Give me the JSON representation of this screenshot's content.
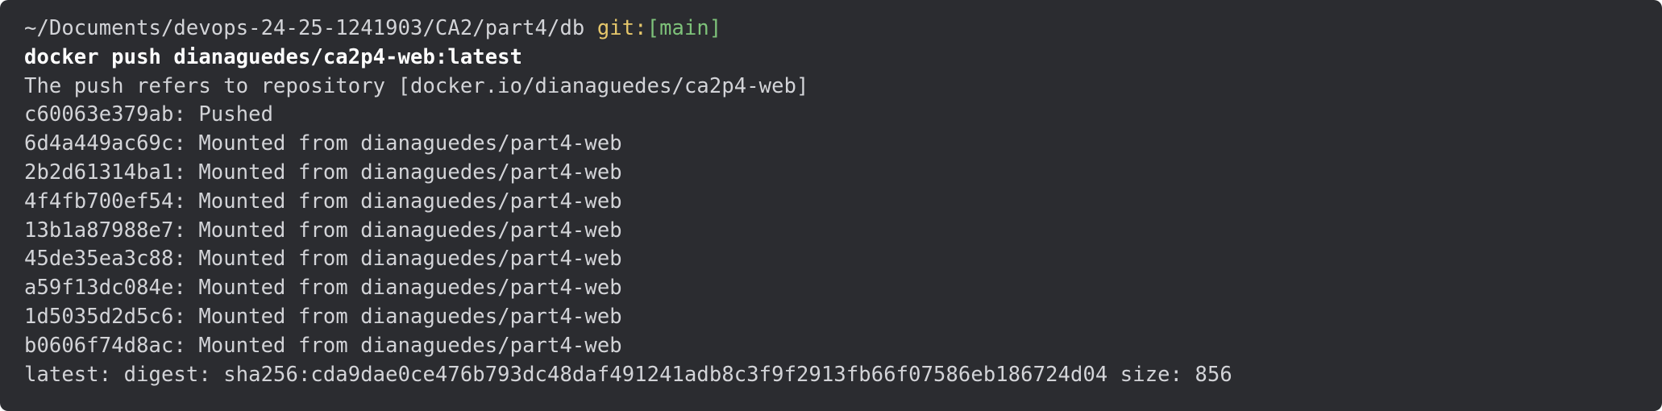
{
  "prompt": {
    "path": "~/Documents/devops-24-25-1241903/CA2/part4/db",
    "git_label": "git:",
    "branch_open": "[",
    "branch": "main",
    "branch_close": "]"
  },
  "command": "docker push dianaguedes/ca2p4-web:latest",
  "output": {
    "repo_line": "The push refers to repository [docker.io/dianaguedes/ca2p4-web]",
    "layers": [
      {
        "id": "c60063e379ab",
        "status": "Pushed"
      },
      {
        "id": "6d4a449ac69c",
        "status": "Mounted from dianaguedes/part4-web"
      },
      {
        "id": "2b2d61314ba1",
        "status": "Mounted from dianaguedes/part4-web"
      },
      {
        "id": "4f4fb700ef54",
        "status": "Mounted from dianaguedes/part4-web"
      },
      {
        "id": "13b1a87988e7",
        "status": "Mounted from dianaguedes/part4-web"
      },
      {
        "id": "45de35ea3c88",
        "status": "Mounted from dianaguedes/part4-web"
      },
      {
        "id": "a59f13dc084e",
        "status": "Mounted from dianaguedes/part4-web"
      },
      {
        "id": "1d5035d2d5c6",
        "status": "Mounted from dianaguedes/part4-web"
      },
      {
        "id": "b0606f74d8ac",
        "status": "Mounted from dianaguedes/part4-web"
      }
    ],
    "digest_line": "latest: digest: sha256:cda9dae0ce476b793dc48daf491241adb8c3f9f2913fb66f07586eb186724d04 size: 856"
  },
  "colors": {
    "background": "#2b2c30",
    "text": "#d3d4d8",
    "git_label": "#e6c76b",
    "branch": "#7ec27a",
    "command": "#ffffff"
  }
}
